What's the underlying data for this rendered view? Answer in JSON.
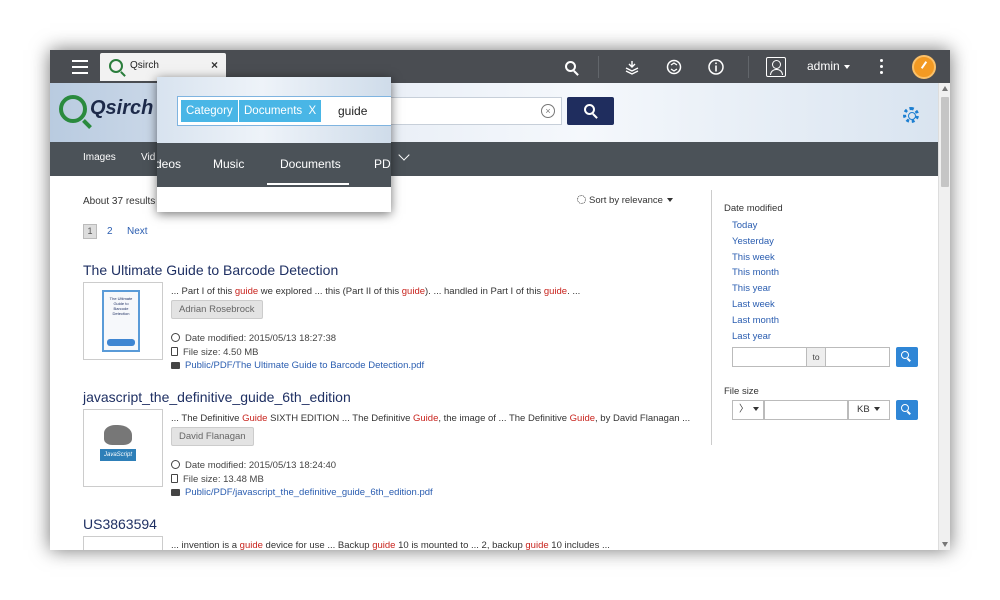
{
  "topbar": {
    "tab_label": "Qsirch",
    "tab_close": "×",
    "user": "admin"
  },
  "header": {
    "logo": "Qsirch",
    "clear_icon": "×"
  },
  "nav": {
    "items": [
      "Images",
      "Vid"
    ]
  },
  "popup": {
    "chip_category": "Category",
    "chip_documents": "Documents  X",
    "query": "guide",
    "nav": [
      "deos",
      "Music",
      "Documents",
      "PDF"
    ]
  },
  "results_header": {
    "count": "About 37 results",
    "sort": "Sort by relevance"
  },
  "pagination": {
    "current": "1",
    "page2": "2",
    "next": "Next"
  },
  "results": [
    {
      "title": "The Ultimate Guide to Barcode Detection",
      "snippet": [
        {
          "t": "... Part I of this "
        },
        {
          "h": "guide"
        },
        {
          "t": " we explored ... this (Part II of this "
        },
        {
          "h": "guide"
        },
        {
          "t": "). ... handled in Part I of this "
        },
        {
          "h": "guide"
        },
        {
          "t": ". ..."
        }
      ],
      "author": "Adrian Rosebrock",
      "modified": "Date modified: 2015/05/13 18:27:38",
      "size": "File size: 4.50 MB",
      "path": "Public/PDF/The Ultimate Guide to Barcode Detection.pdf",
      "thumb_text": "The Ultimate Guide to Barcode Detection"
    },
    {
      "title": "javascript_the_definitive_guide_6th_edition",
      "snippet": [
        {
          "t": "... The Definitive "
        },
        {
          "h": "Guide"
        },
        {
          "t": " SIXTH EDITION ... The Definitive "
        },
        {
          "h": "Guide"
        },
        {
          "t": ", the image of ... The Definitive "
        },
        {
          "h": "Guide"
        },
        {
          "t": ", by David Flanagan ..."
        }
      ],
      "author": "David Flanagan",
      "modified": "Date modified: 2015/05/13 18:24:40",
      "size": "File size: 13.48 MB",
      "path": "Public/PDF/javascript_the_definitive_guide_6th_edition.pdf",
      "thumb_text": "JavaScript"
    },
    {
      "title": "US3863594",
      "snippet": [
        {
          "t": "... invention is a "
        },
        {
          "h": "guide"
        },
        {
          "t": " device for use ... Backup "
        },
        {
          "h": "guide"
        },
        {
          "t": " 10 is mounted to ... 2, backup "
        },
        {
          "h": "guide"
        },
        {
          "t": " 10 includes ..."
        }
      ]
    }
  ],
  "sidebar": {
    "date_title": "Date modified",
    "date_links": [
      "Today",
      "Yesterday",
      "This week",
      "This month",
      "This year",
      "Last week",
      "Last month",
      "Last year"
    ],
    "to_label": "to",
    "size_title": "File size",
    "size_op": "〉",
    "size_unit": "KB"
  },
  "colors": {
    "highlight": "#c8231d",
    "link": "#2a5db0",
    "chip": "#49b6e6",
    "search_button": "#1f2d5e"
  }
}
